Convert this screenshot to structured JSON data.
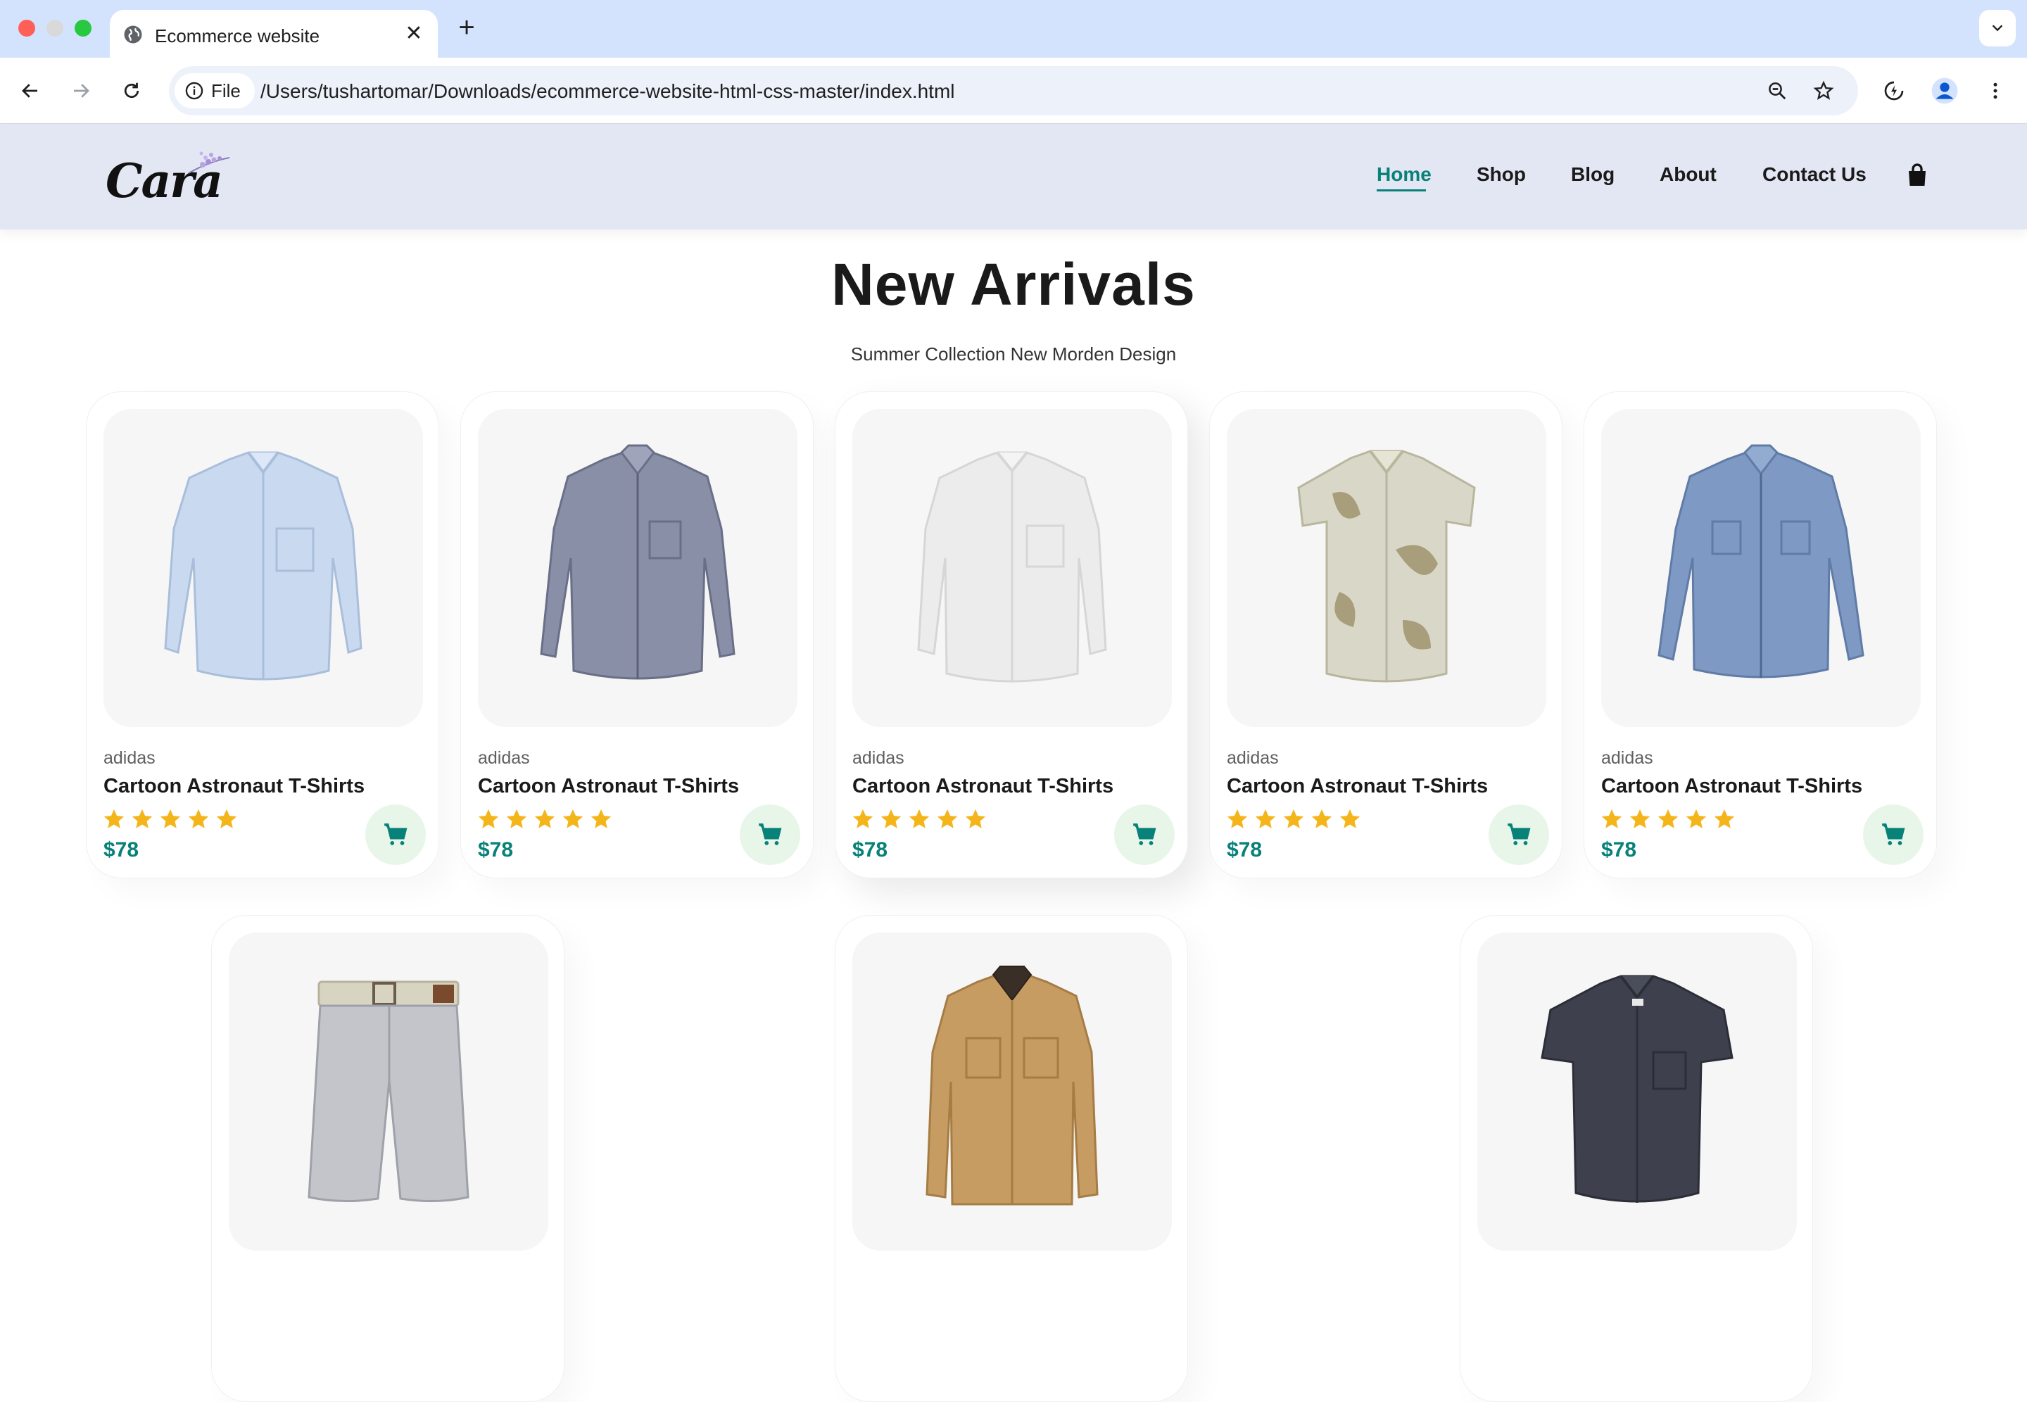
{
  "browser": {
    "tab_title": "Ecommerce website",
    "tab_close": "✕",
    "new_tab": "+",
    "tab_menu": "⌄",
    "chip_label": "File",
    "url": "/Users/tushartomar/Downloads/ecommerce-website-html-css-master/index.html"
  },
  "header": {
    "logo_text": "Cara",
    "nav": [
      "Home",
      "Shop",
      "Blog",
      "About",
      "Contact Us"
    ],
    "active_nav": "Home",
    "accent_color": "#088178",
    "background_color": "#e3e6f3"
  },
  "section": {
    "title": "New Arrivals",
    "subtitle": "Summer Collection New Morden Design"
  },
  "products": [
    {
      "brand": "adidas",
      "name": "Cartoon Astronaut T-Shirts",
      "rating": 5,
      "price": "$78",
      "image": "light-blue-shirt"
    },
    {
      "brand": "adidas",
      "name": "Cartoon Astronaut T-Shirts",
      "rating": 5,
      "price": "$78",
      "image": "grey-patterned-shirt"
    },
    {
      "brand": "adidas",
      "name": "Cartoon Astronaut T-Shirts",
      "rating": 5,
      "price": "$78",
      "image": "white-shirt"
    },
    {
      "brand": "adidas",
      "name": "Cartoon Astronaut T-Shirts",
      "rating": 5,
      "price": "$78",
      "image": "floral-short-sleeve-shirt"
    },
    {
      "brand": "adidas",
      "name": "Cartoon Astronaut T-Shirts",
      "rating": 5,
      "price": "$78",
      "image": "denim-shirt"
    },
    {
      "image": "grey-shorts"
    },
    {
      "image": "khaki-jacket"
    },
    {
      "image": "dark-short-sleeve-shirt"
    }
  ],
  "colors": {
    "star": "#f3b519",
    "price": "#088178",
    "cart_bg": "#e8f6ea",
    "image_bg": "#f6f6f6"
  }
}
